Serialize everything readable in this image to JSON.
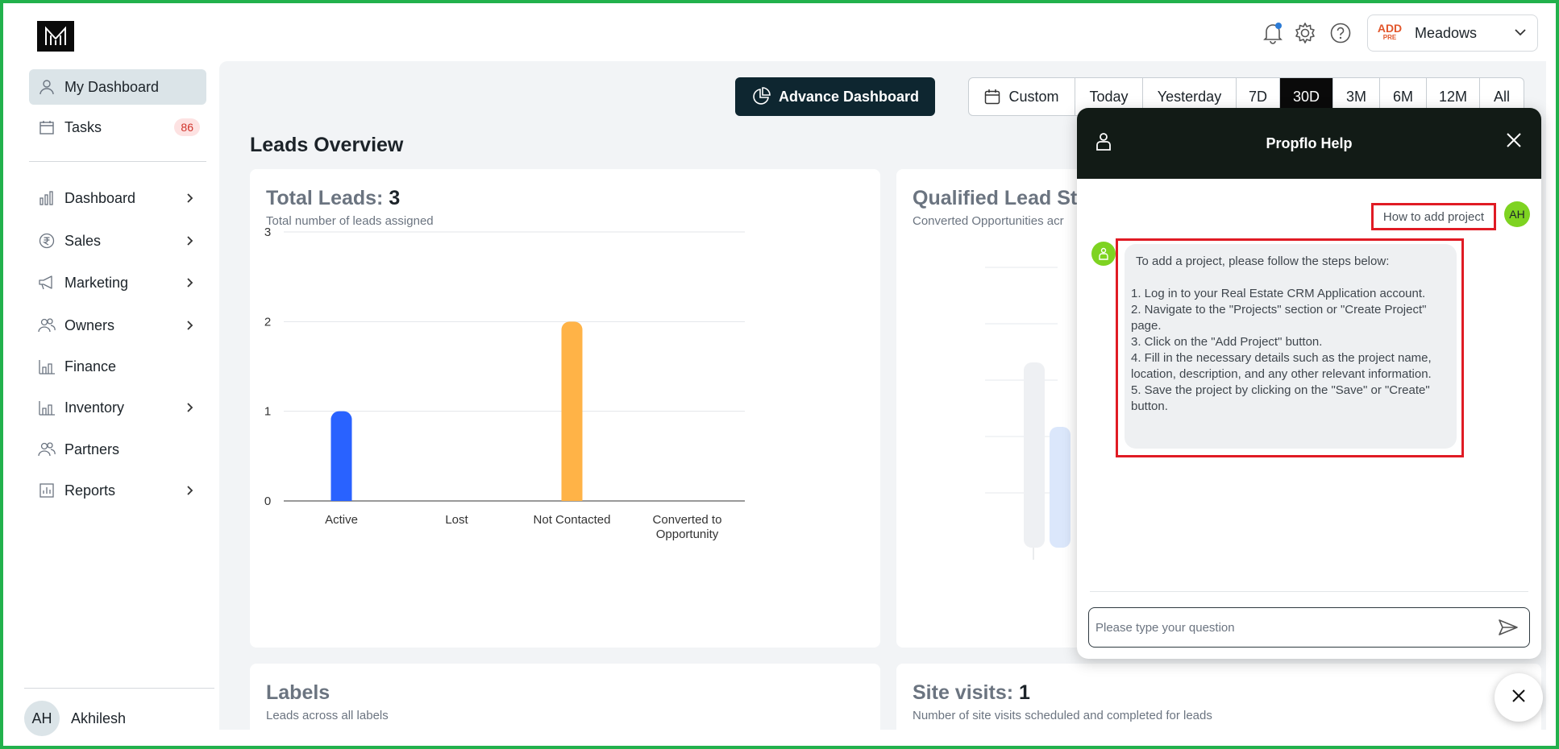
{
  "topbar": {
    "org_logo_line1": "ADD",
    "org_logo_line2": "PRE",
    "org_name": "Meadows"
  },
  "sidebar": {
    "items": [
      {
        "label": "My Dashboard"
      },
      {
        "label": "Tasks",
        "badge": "86"
      },
      {
        "label": "Dashboard"
      },
      {
        "label": "Sales"
      },
      {
        "label": "Marketing"
      },
      {
        "label": "Owners"
      },
      {
        "label": "Finance"
      },
      {
        "label": "Inventory"
      },
      {
        "label": "Partners"
      },
      {
        "label": "Reports"
      }
    ],
    "user": {
      "initials": "AH",
      "name": "Akhilesh"
    }
  },
  "main": {
    "advance_label": "Advance Dashboard",
    "ranges": [
      "Custom",
      "Today",
      "Yesterday",
      "7D",
      "30D",
      "3M",
      "6M",
      "12M",
      "All"
    ],
    "selected_range": "30D",
    "section_title": "Leads Overview",
    "total_leads": {
      "title": "Total Leads:",
      "value": "3",
      "subtitle": "Total number of leads assigned"
    },
    "qualified": {
      "title": "Qualified Lead St",
      "subtitle": "Converted Opportunities acr"
    },
    "labels": {
      "title": "Labels",
      "subtitle": "Leads across all labels"
    },
    "site_visits": {
      "title": "Site visits:",
      "value": "1",
      "subtitle": "Number of site visits scheduled and completed for leads"
    }
  },
  "chart_data": {
    "type": "bar",
    "categories": [
      "Active",
      "Lost",
      "Not Contacted",
      "Converted to Opportunity"
    ],
    "values": [
      1,
      0,
      2,
      0
    ],
    "colors": [
      "#2962ff",
      "#2962ff",
      "#ffb347",
      "#2962ff"
    ],
    "yticks": [
      0,
      1,
      2,
      3
    ],
    "ylim": [
      0,
      3
    ],
    "grid": true
  },
  "help": {
    "title": "Propflo Help",
    "user_message": "How to add project",
    "user_initials": "AH",
    "bot_intro": "To add a project, please follow the steps below:",
    "bot_steps": [
      "1. Log in to your Real Estate CRM Application account.",
      "2. Navigate to the \"Projects\" section or \"Create Project\" page.",
      "3. Click on the \"Add Project\" button.",
      "4. Fill in the necessary details such as the project name, location, description, and any other relevant information.",
      "5. Save the project by clicking on the \"Save\" or \"Create\" button."
    ],
    "input_placeholder": "Please type your question"
  },
  "icons": {
    "notification": "bell-icon",
    "settings": "gear-icon",
    "help": "question-icon",
    "send": "send-icon",
    "close": "close-icon"
  },
  "colors": {
    "accent_dark": "#0e2630",
    "highlight_red": "#e01b24",
    "avatar_green": "#7ed321",
    "bar_blue": "#2962ff",
    "bar_orange": "#ffb347"
  }
}
